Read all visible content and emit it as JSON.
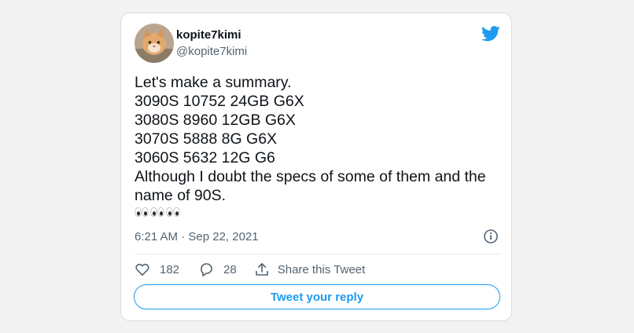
{
  "tweet": {
    "author": {
      "name": "kopite7kimi",
      "handle": "@kopite7kimi"
    },
    "text_lines": [
      "Let's make a summary.",
      "3090S 10752 24GB G6X",
      "3080S 8960 12GB G6X",
      "3070S 5888 8G G6X",
      "3060S 5632 12G G6",
      "Although I doubt the specs of some of them and the",
      "name of 90S."
    ],
    "emoji": [
      "eyes",
      "eyes",
      "eyes"
    ],
    "timestamp": "6:21 AM · Sep 22, 2021",
    "actions": {
      "likes": "182",
      "replies": "28",
      "share_label": "Share this Tweet"
    },
    "reply_button_label": "Tweet your reply"
  },
  "colors": {
    "brand": "#1d9bf0",
    "text_primary": "#0f1419",
    "text_secondary": "#536471",
    "background": "#f2f2f2"
  }
}
